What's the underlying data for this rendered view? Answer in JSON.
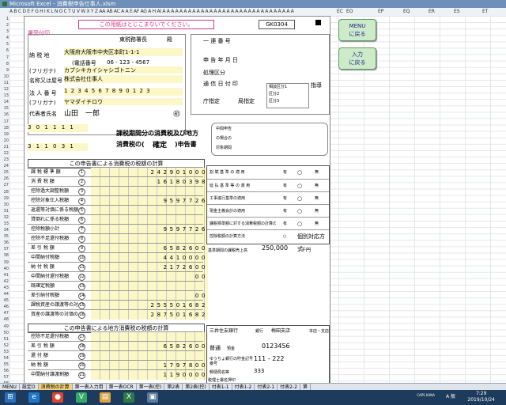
{
  "window": {
    "title": "Microsoft Excel - 消費税申告仕事人.xlsm"
  },
  "columns": {
    "main_headers": "A B  C  D E F G H I  K L N O C T U V  W X Y  Z AA AB AC A A E AF AG  A H AI A A A A A A A A A A A A A A A A A A A A A A A A A A A A A A A",
    "right": [
      "EC",
      "EO",
      "EP",
      "EQ",
      "ER",
      "ES",
      "ET"
    ]
  },
  "rows": [
    "1",
    "2",
    "3",
    "4",
    "5",
    "6",
    "7",
    "8",
    "9",
    "10",
    "11",
    "12",
    "13",
    "14",
    "15",
    "16",
    "17",
    "18",
    "19",
    "20",
    "21",
    "22",
    "23",
    "24",
    "25",
    "26",
    "27",
    "28",
    "29",
    "30",
    "31",
    "32",
    "33",
    "34",
    "35",
    "36",
    "37",
    "38",
    "39",
    "40",
    "41",
    "42",
    "43",
    "44",
    "45",
    "46",
    "47",
    "48",
    "49",
    "50",
    "51",
    "52",
    "53",
    "54",
    "55",
    "56",
    "57",
    "58"
  ],
  "form": {
    "banner": "この用紙はとじこまないでください。",
    "form_code": "GK0304",
    "received_label": "署受付印",
    "tax_office": "東税務署長",
    "dono": "殿",
    "address_label": "納 税 地",
    "address": "大阪府大阪市中央区本町1-1-1",
    "phone_label": "(電話番号",
    "phone": "06  ‐  123  ‐  4567",
    "furigana_label": "(フリガナ)",
    "company_kana": "カブシキカイシャシゴトニン",
    "company_name_label": "名称又は屋号",
    "company_name": "株式会社仕事人",
    "corp_no_label": "法 人 番 号",
    "corp_no": "1 2 3 4 5 6 7 8 9 0 1 2 3",
    "rep_kana": "ヤマダイチロウ",
    "rep_label": "代表者氏名",
    "rep_name": "山田　一郎",
    "seal": "㊞",
    "period_from": "3 0 1 1 1 1",
    "period_to": "3 1 1 0 3 1",
    "period_title": "課税期間分の消費税及び地方",
    "kind_pre": "消費税の(",
    "kind": "確定",
    "kind_post": ")申告書",
    "right_labels": [
      "一 連 番 号",
      "申 告 年 月 日",
      "処理区分",
      "通 信 日 付 印",
      "指導",
      "庁指定",
      "局指定",
      "相談区分1",
      "区分2",
      "区分3"
    ],
    "interim_labels": [
      "中間申告",
      "の場合の",
      "対象期間"
    ],
    "section1_title": "この申告書による消費税の税額の計算",
    "section2_title": "この申告書による地方消費税の税額の計算",
    "calc_rows": [
      {
        "label": "課 税 標 準 額",
        "num": "1",
        "value": "242901000"
      },
      {
        "label": "消 費 税 額",
        "num": "2",
        "value": "16180398"
      },
      {
        "label": "控除過大調整税額",
        "num": "3",
        "value": ""
      },
      {
        "label": "控除対象仕入税額",
        "num": "4",
        "value": "9597726"
      },
      {
        "label": "返還等対価に係る税額",
        "num": "5",
        "value": ""
      },
      {
        "label": "貸倒れに係る税額",
        "num": "6",
        "value": ""
      },
      {
        "label": "控除税額小計",
        "num": "7",
        "value": "9597726"
      },
      {
        "label": "控除不足還付税額",
        "num": "8",
        "value": ""
      },
      {
        "label": "差 引 税 額",
        "num": "9",
        "value": "6582600"
      },
      {
        "label": "中間納付税額",
        "num": "10",
        "value": "4410000"
      },
      {
        "label": "納 付 税 額",
        "num": "11",
        "value": "2172600"
      },
      {
        "label": "中間納付還付税額",
        "num": "12",
        "value": "00"
      },
      {
        "label": "既確定税額",
        "num": "13",
        "value": ""
      },
      {
        "label": "差引納付税額",
        "num": "14",
        "value": "00"
      },
      {
        "label": "課税資産の譲渡等の対価の額",
        "num": "15",
        "value": "255501682"
      },
      {
        "label": "資産の譲渡等の対価の額",
        "num": "16",
        "value": "287501682"
      }
    ],
    "local_rows": [
      {
        "label": "控除不足還付税額",
        "num": "17",
        "value": ""
      },
      {
        "label": "差 引 税 額",
        "num": "18",
        "value": "6582600"
      },
      {
        "label": "還 付 額",
        "num": "19",
        "value": ""
      },
      {
        "label": "納 税 額",
        "num": "20",
        "value": "1797800"
      },
      {
        "label": "中間納付譲渡割額",
        "num": "21",
        "value": "1190000"
      }
    ],
    "checks": [
      {
        "label": "割 賦 基 準 の 適 用",
        "a": "有",
        "b": "○",
        "c": "無"
      },
      {
        "label": "延 払 基 準 等 の 適 用",
        "a": "有",
        "b": "○",
        "c": "無"
      },
      {
        "label": "工事進行基準の適用",
        "a": "有",
        "b": "○",
        "c": "無"
      },
      {
        "label": "現金主義会計の適用",
        "a": "有",
        "b": "○",
        "c": "無"
      },
      {
        "label": "課税標準額に対する消費税額の計算の特例の適用",
        "a": "有",
        "b": "○",
        "c": "無"
      },
      {
        "label": "控除税額の計算方法",
        "a": "○",
        "b": "個別対応方式",
        "c": ""
      }
    ],
    "base_amount_label": "基準期間の課税売上高",
    "base_amount": "250,000",
    "base_amount_unit": "千円",
    "bank_name": "三井住友銀行",
    "bank_type": "銀行",
    "branch_name": "梅田支店",
    "branch_label": "本店・支店",
    "deposit_type": "普通",
    "deposit_label": "預金",
    "account_no": "0123456",
    "postal_label": "ゆうちょ銀行の貯金記号番号",
    "postal_no": "111 - 222",
    "post_office_label": "郵便局名等",
    "post_office": "333",
    "tax_accountant_label": "税理士署名押印"
  },
  "buttons": {
    "menu": "MENU\nに戻る",
    "input": "入力\nに戻る"
  },
  "sheet_tabs": [
    "MENU",
    "設定O",
    "消費税の計算",
    "第一表入力用",
    "第一表OCR",
    "第一表(控)",
    "第2表",
    "第2表(控)",
    "付表1-1",
    "付表1-2",
    "付表2-1",
    "付表2-2",
    "第"
  ],
  "taskbar": {
    "ime": "A 般",
    "tray_label": "CAPS KANA",
    "time": "7:29",
    "date": "2019/10/24"
  }
}
